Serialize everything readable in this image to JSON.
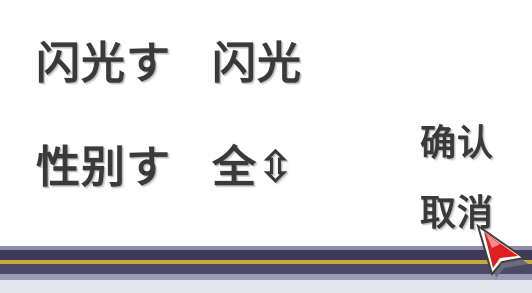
{
  "menu": {
    "rows": [
      {
        "label": "闪光す",
        "value": "闪光"
      },
      {
        "label": "性别す",
        "value": "全⇳"
      }
    ],
    "confirm_label": "确认",
    "cancel_label": "取消"
  },
  "colors": {
    "text": "#3a3a3a",
    "frame_dark": "#3c3c58",
    "frame_gold": "#c8a838",
    "cursor_red": "#e02020"
  },
  "icons": {
    "cursor": "red-arrow-cursor-icon"
  }
}
